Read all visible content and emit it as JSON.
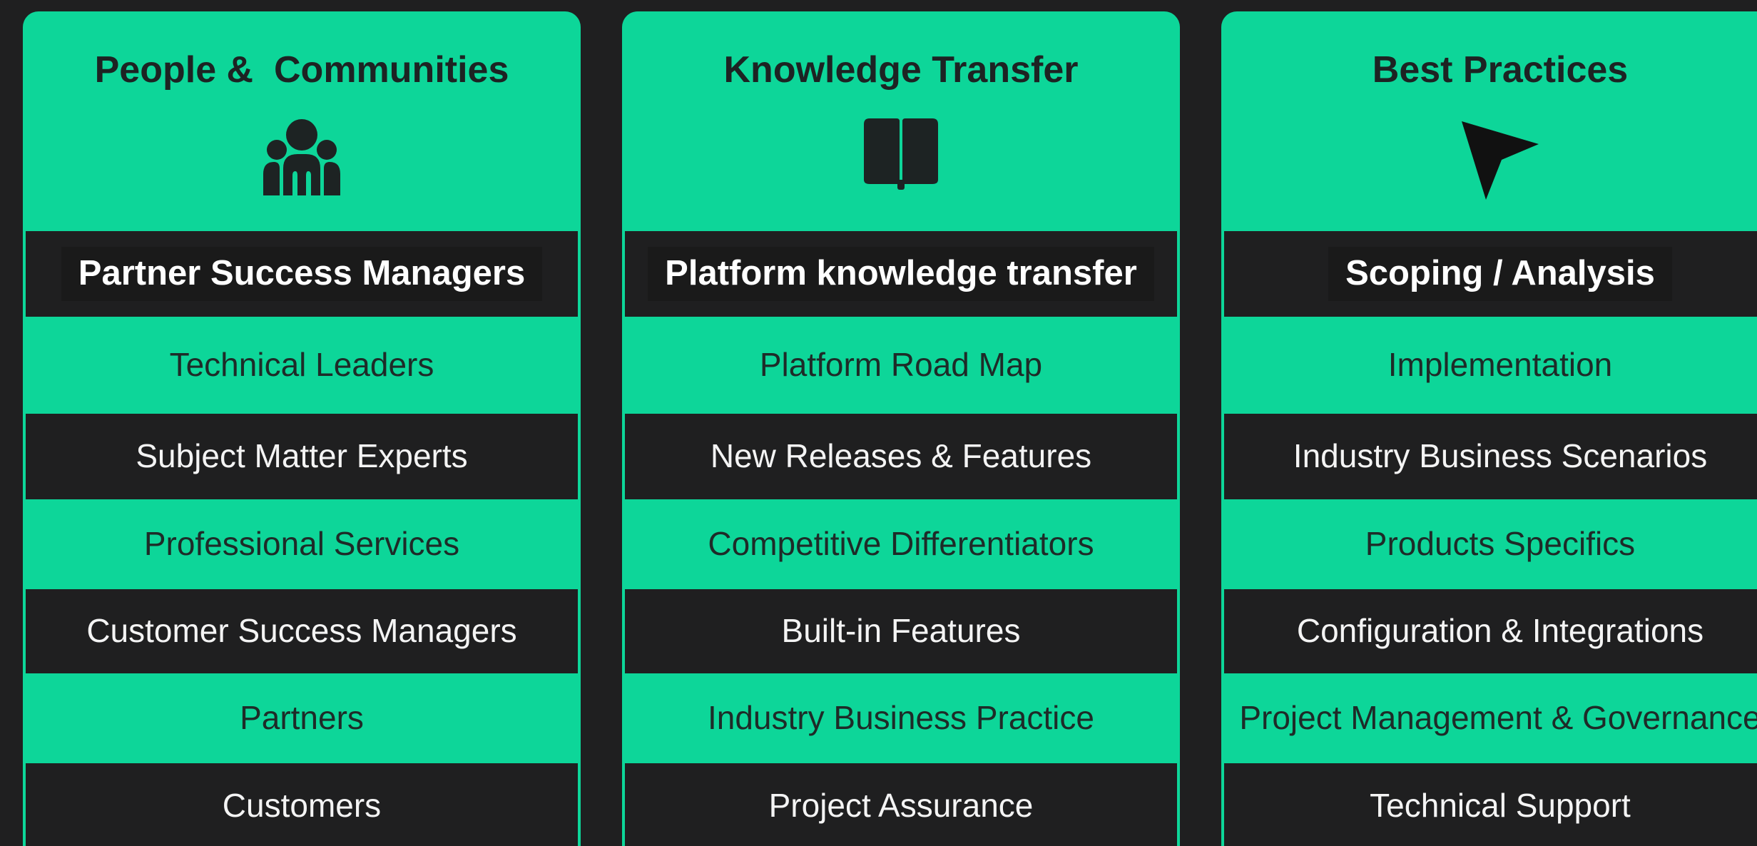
{
  "columns": [
    {
      "title": "People &  Communities",
      "icon": "people-group-icon",
      "rows": [
        {
          "label": "Partner Success Managers",
          "style": "dark-bold"
        },
        {
          "label": "Technical Leaders",
          "style": "green"
        },
        {
          "label": "Subject Matter Experts",
          "style": "dark"
        },
        {
          "label": "Professional Services",
          "style": "green"
        },
        {
          "label": "Customer Success Managers",
          "style": "dark"
        },
        {
          "label": "Partners",
          "style": "green"
        },
        {
          "label": "Customers",
          "style": "dark"
        }
      ]
    },
    {
      "title": "Knowledge Transfer",
      "icon": "book-icon",
      "rows": [
        {
          "label": "Platform knowledge transfer",
          "style": "dark-bold"
        },
        {
          "label": "Platform Road Map",
          "style": "green"
        },
        {
          "label": "New Releases & Features",
          "style": "dark"
        },
        {
          "label": "Competitive Differentiators",
          "style": "green"
        },
        {
          "label": "Built-in Features",
          "style": "dark"
        },
        {
          "label": "Industry Business Practice",
          "style": "green"
        },
        {
          "label": "Project Assurance",
          "style": "dark"
        }
      ]
    },
    {
      "title": "Best Practices",
      "icon": "cursor-arrow-icon",
      "rows": [
        {
          "label": "Scoping / Analysis",
          "style": "dark-bold"
        },
        {
          "label": "Implementation",
          "style": "green"
        },
        {
          "label": "Industry Business Scenarios",
          "style": "dark"
        },
        {
          "label": "Products Specifics",
          "style": "green"
        },
        {
          "label": "Configuration & Integrations",
          "style": "dark"
        },
        {
          "label": "Project Management  & Governance",
          "style": "green"
        },
        {
          "label": "Technical Support",
          "style": "dark"
        }
      ]
    }
  ],
  "colors": {
    "background": "#1f1f20",
    "accent": "#0dd699",
    "dark_row": "#1f1f20",
    "light_text": "#f4f4f4",
    "dark_text": "#1e2b28"
  }
}
